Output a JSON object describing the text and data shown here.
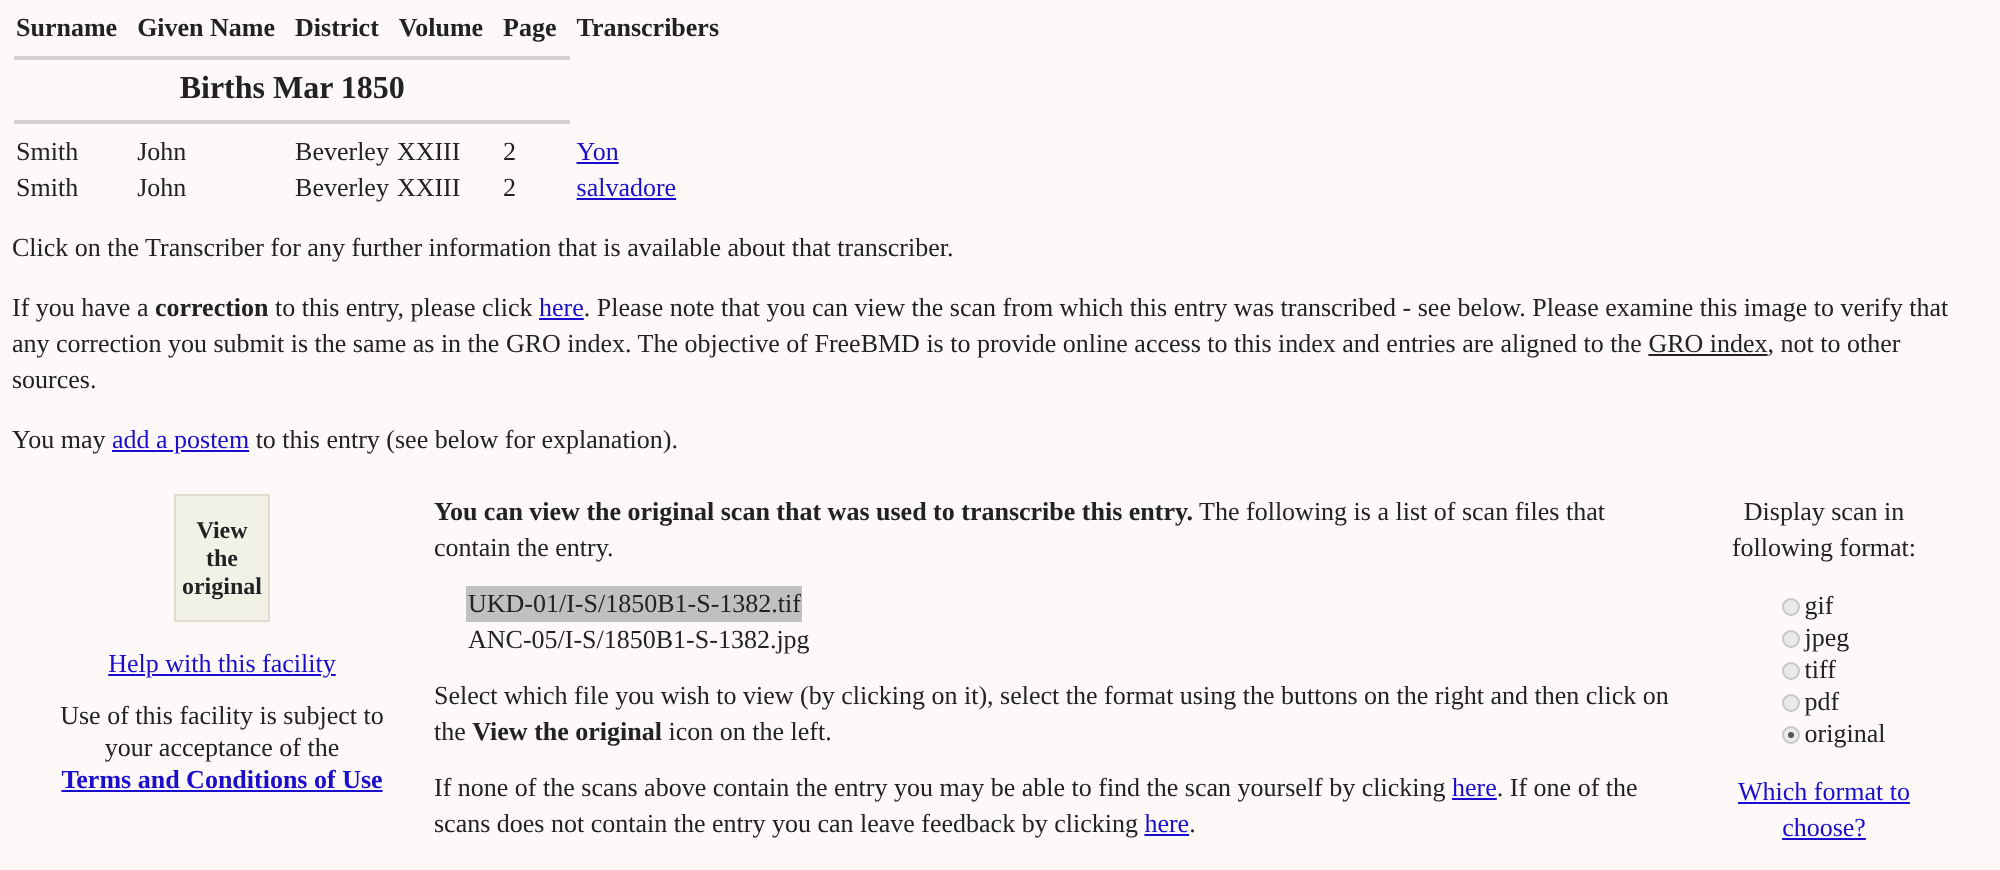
{
  "table": {
    "columns": [
      "Surname",
      "Given Name",
      "District",
      "Volume",
      "Page",
      "Transcribers"
    ],
    "section_title": "Births Mar 1850",
    "rows": [
      {
        "surname": "Smith",
        "given_name": "John",
        "district": "Beverley",
        "volume": "XXIII",
        "page": "2",
        "transcriber": "Yon"
      },
      {
        "surname": "Smith",
        "given_name": "John",
        "district": "Beverley",
        "volume": "XXIII",
        "page": "2",
        "transcriber": "salvadore"
      }
    ]
  },
  "paragraphs": [
    [
      {
        "kind": "text",
        "text": "Click on the Transcriber for any further information that is available about that transcriber."
      }
    ],
    [
      {
        "kind": "text",
        "text": "If you have a **correction** to this entry, please click "
      },
      {
        "kind": "link",
        "text": "here"
      },
      {
        "kind": "text",
        "text": ". Please note that you can view the scan from which this entry was transcribed - see below. Please examine this image to verify that any correction you submit is the same as in the GRO index. The objective of FreeBMD is to provide online access to this index and entries are aligned to the "
      },
      {
        "kind": "visited-link",
        "text": "GRO index"
      },
      {
        "kind": "text",
        "text": ", not to other sources."
      }
    ],
    [
      {
        "kind": "text",
        "text": "You may "
      },
      {
        "kind": "link",
        "text": "add a postem"
      },
      {
        "kind": "text",
        "text": " to this entry (see below for explanation)."
      }
    ]
  ],
  "scan_panel": {
    "view_icon_text": "View the original",
    "help_link": "Help with this facility",
    "terms": [
      {
        "kind": "text",
        "text": "Use of this facility is subject to your acceptance of the "
      },
      {
        "kind": "bold-link",
        "text": "Terms and Conditions of Use"
      }
    ],
    "intro": [
      {
        "kind": "text",
        "text": "**You can view the original scan that was used to transcribe this entry.** The following is a list of scan files that contain the entry."
      }
    ],
    "files": [
      {
        "name": "UKD-01/I-S/1850B1-S-1382.tif",
        "selected": true
      },
      {
        "name": "ANC-05/I-S/1850B1-S-1382.jpg",
        "selected": false
      }
    ],
    "instructions": [
      {
        "kind": "text",
        "text": "Select which file you wish to view (by clicking on it), select the format using the buttons on the right and then click on the **View the original** icon on the left."
      }
    ],
    "feedback": [
      {
        "kind": "text",
        "text": "If none of the scans above contain the entry you may be able to find the scan yourself by clicking "
      },
      {
        "kind": "link",
        "text": "here"
      },
      {
        "kind": "text",
        "text": ". If one of the scans does not contain the entry you can leave feedback by clicking "
      },
      {
        "kind": "link",
        "text": "here"
      },
      {
        "kind": "text",
        "text": "."
      }
    ],
    "format_label": "Display scan in following format:",
    "formats": [
      {
        "label": "gif",
        "selected": false
      },
      {
        "label": "jpeg",
        "selected": false
      },
      {
        "label": "tiff",
        "selected": false
      },
      {
        "label": "pdf",
        "selected": false
      },
      {
        "label": "original",
        "selected": true
      }
    ],
    "format_help_link": "Which format to choose?"
  }
}
